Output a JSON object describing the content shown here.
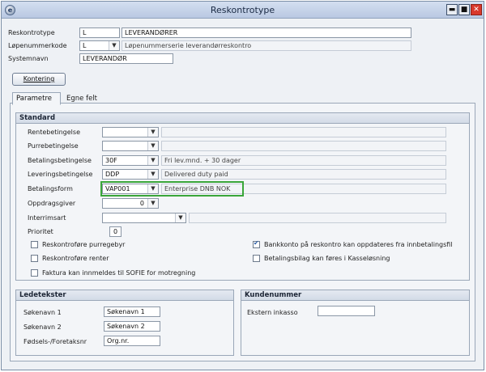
{
  "window": {
    "title": "Reskontrotype",
    "icon": "app-logo-icon",
    "controls": {
      "minimize": "▬",
      "maximize": "■",
      "close": "✕"
    }
  },
  "header": {
    "reskontrotype_label": "Reskontrotype",
    "reskontrotype_code": "L",
    "reskontrotype_name": "LEVERANDØRER",
    "lopenummerkode_label": "Løpenummerkode",
    "lopenummerkode_value": "L",
    "lopenummerkode_desc": "Løpenummerserie leverandørreskontro",
    "systemnavn_label": "Systemnavn",
    "systemnavn_value": "LEVERANDØR",
    "kontering_button": "Kontering"
  },
  "tabs": [
    {
      "label": "Parametre",
      "active": true
    },
    {
      "label": "Egne felt",
      "active": false
    }
  ],
  "standard": {
    "title": "Standard",
    "rows": [
      {
        "label": "Rentebetingelse",
        "value": "",
        "desc": ""
      },
      {
        "label": "Purrebetingelse",
        "value": "",
        "desc": ""
      },
      {
        "label": "Betalingsbetingelse",
        "value": "30F",
        "desc": "Fri lev.mnd. + 30 dager"
      },
      {
        "label": "Leveringsbetingelse",
        "value": "DDP",
        "desc": "Delivered duty paid"
      },
      {
        "label": "Betalingsform",
        "value": "VAP001",
        "desc": "Enterprise DNB NOK"
      },
      {
        "label": "Oppdragsgiver",
        "value": "0",
        "desc": ""
      },
      {
        "label": "Interrimsart",
        "value": "",
        "desc": ""
      },
      {
        "label": "Prioritet",
        "value": "0",
        "desc": ""
      }
    ],
    "checkboxes_left": [
      {
        "label": "Reskontroføre purregebyr",
        "checked": false
      },
      {
        "label": "Reskontroføre renter",
        "checked": false
      },
      {
        "label": "Faktura kan innmeldes til SOFIE for motregning",
        "checked": false
      }
    ],
    "checkboxes_right": [
      {
        "label": "Bankkonto på reskontro kan oppdateres fra innbetalingsfil",
        "checked": true
      },
      {
        "label": "Betalingsbilag kan føres i Kasseløsning",
        "checked": false
      }
    ]
  },
  "ledetekster": {
    "title": "Ledetekster",
    "rows": [
      {
        "label": "Søkenavn 1",
        "value": "Søkenavn 1"
      },
      {
        "label": "Søkenavn 2",
        "value": "Søkenavn 2"
      },
      {
        "label": "Fødsels-/Foretaksnr",
        "value": "Org.nr."
      }
    ]
  },
  "kundenummer": {
    "title": "Kundenummer",
    "label": "Ekstern inkasso",
    "value": ""
  },
  "colors": {
    "highlight": "#3aa63a",
    "close_button": "#d9382b"
  }
}
